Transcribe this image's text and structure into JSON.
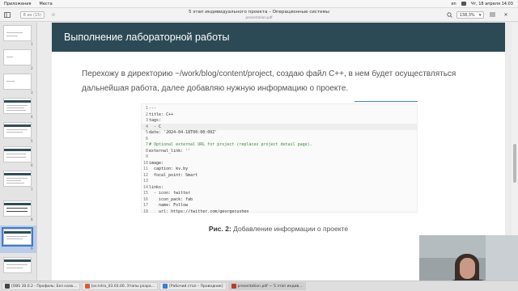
{
  "system_bar": {
    "menus": [
      "Приложения",
      "Места"
    ],
    "lang": "en",
    "datetime": "Чт, 18 апреля 14:03"
  },
  "app": {
    "page_indicator": "8 из (15)",
    "doc_title": "5 этап индивидуального проекта – Операционные системы",
    "doc_subtitle": "presentation.pdf",
    "zoom": "138,3%",
    "zoom_arrow": "▾",
    "sidebar_icon": "sidebar-toggle-icon",
    "star_icon": "star-icon",
    "search_icon": "search-icon",
    "menu_icon": "hamburger-menu-icon",
    "close_icon": "close-icon"
  },
  "thumbnails": [
    {
      "num": "1"
    },
    {
      "num": "2"
    },
    {
      "num": "3"
    },
    {
      "num": "4"
    },
    {
      "num": "5"
    },
    {
      "num": "6"
    },
    {
      "num": "7"
    },
    {
      "num": "8"
    },
    {
      "num": "9"
    }
  ],
  "slide": {
    "title": "Выполнение лабораторной работы",
    "text": "Перехожу в директорию ~/work/blog/content/project, создаю файл C++, в нем будет осуществляться дальнейшая работа, далее добавляю нужную информацию о проекте.",
    "code_lines": [
      {
        "n": "1",
        "t": "---"
      },
      {
        "n": "2",
        "t": "title: C++"
      },
      {
        "n": "3",
        "t": "tags:"
      },
      {
        "n": "4",
        "t": "  - C"
      },
      {
        "n": "5",
        "t": "date: '2024-04-18T00:00:00Z'"
      },
      {
        "n": "6",
        "t": ""
      },
      {
        "n": "7",
        "t": "# Optional external URL for project (replaces project detail page)."
      },
      {
        "n": "8",
        "t": "external_link: ''"
      },
      {
        "n": "9",
        "t": ""
      },
      {
        "n": "10",
        "t": "image:"
      },
      {
        "n": "11",
        "t": "  caption: kv.by"
      },
      {
        "n": "12",
        "t": "  focal_point: Smart"
      },
      {
        "n": "13",
        "t": ""
      },
      {
        "n": "14",
        "t": "links:"
      },
      {
        "n": "15",
        "t": "  - icon: twitter"
      },
      {
        "n": "16",
        "t": "    icon_pack: fab"
      },
      {
        "n": "17",
        "t": "    name: Follow"
      },
      {
        "n": "18",
        "t": "    url: https://twitter.com/georgecushen"
      }
    ],
    "caption_label": "Рис. 2:",
    "caption_text": " Добавление информации о проекте"
  },
  "taskbar": [
    {
      "label": "[OBS 30.0.2 - Профиль: Без назв…",
      "color": "#444444"
    },
    {
      "label": "[os-intro_03.03.00. Этапы разра…",
      "color": "#e05a2b"
    },
    {
      "label": "[Рабочий стол – Проводник]",
      "color": "#3d7bd1"
    },
    {
      "label": "presentation.pdf — 5 этап индив…",
      "color": "#c0392b"
    }
  ],
  "colors": {
    "slide_header": "#2c4a55",
    "accent": "#3b8ab7",
    "comment": "#3a8a3a"
  }
}
